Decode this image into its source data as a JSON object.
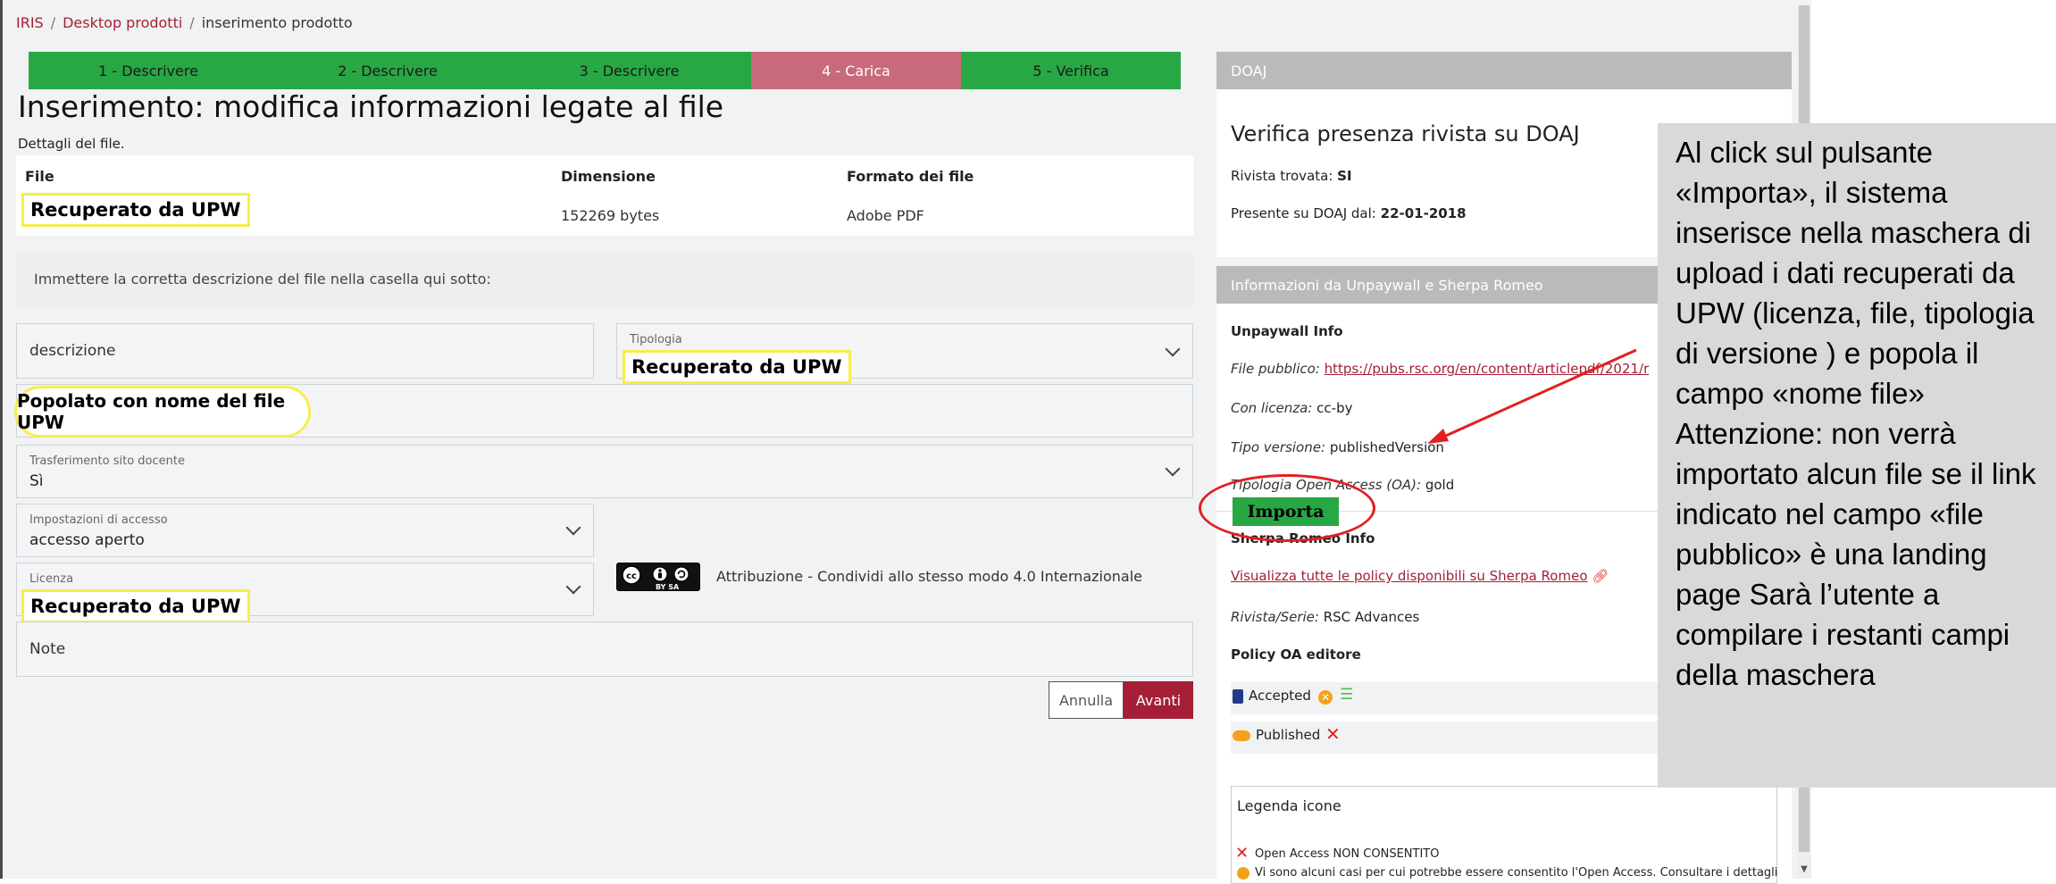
{
  "breadcrumb": {
    "root": "IRIS",
    "sep": "/",
    "desktop": "Desktop prodotti",
    "current": "inserimento prodotto"
  },
  "steps": [
    {
      "label": "1 - Descrivere",
      "state": "done"
    },
    {
      "label": "2 - Descrivere",
      "state": "done"
    },
    {
      "label": "3 - Descrivere",
      "state": "done"
    },
    {
      "label": "4 - Carica",
      "state": "active"
    },
    {
      "label": "5 - Verifica",
      "state": "done"
    }
  ],
  "form": {
    "title": "Inserimento: modifica informazioni legate al file",
    "subtitle": "Dettagli del file.",
    "table": {
      "headers": [
        "File",
        "Dimensione",
        "Formato dei file"
      ],
      "row": {
        "file": "Recuperato da UPW",
        "size": "152269 bytes",
        "format": "Adobe PDF"
      }
    },
    "instruction": "Immettere la corretta descrizione del file nella casella qui sotto:",
    "description_placeholder": "descrizione",
    "tipologia": {
      "label": "Tipologia",
      "value": "Recuperato da UPW"
    },
    "filename_value": "Popolato con nome del file UPW",
    "trasferimento": {
      "label": "Trasferimento sito docente",
      "value": "Sì"
    },
    "accesso": {
      "label": "Impostazioni di accesso",
      "value": "accesso aperto"
    },
    "licenza": {
      "label": "Licenza",
      "value": "Recuperato da UPW"
    },
    "cc_badge": "BY SA",
    "license_text": "Attribuzione - Condividi allo stesso modo 4.0 Internazionale",
    "note_placeholder": "Note",
    "buttons": {
      "cancel": "Annulla",
      "next": "Avanti"
    }
  },
  "doaj": {
    "header": "DOAJ",
    "title": "Verifica presenza rivista su DOAJ",
    "found_label": "Rivista trovata:",
    "found_value": "SI",
    "since_label": "Presente su DOAJ dal:",
    "since_value": "22-01-2018"
  },
  "info": {
    "header": "Informazioni da Unpaywall e Sherpa Romeo",
    "unpaywall_title": "Unpaywall Info",
    "public_file_label": "File pubblico:",
    "public_file_url": "https://pubs.rsc.org/en/content/articlepdf/2021/r",
    "licence_label": "Con licenza:",
    "licence_value": "cc-by",
    "version_label": "Tipo versione:",
    "version_value": "publishedVersion",
    "oa_label": "Tipologia Open Access (OA):",
    "oa_value": "gold",
    "import_button": "Importa",
    "sherpa_title": "Sherpa Romeo Info",
    "sherpa_link": "Visualizza tutte le policy disponibili su Sherpa Romeo",
    "journal_label": "Rivista/Serie:",
    "journal_value": "RSC Advances",
    "policy_title": "Policy OA editore",
    "accepted": "Accepted",
    "published": "Published",
    "legend_title": "Legenda icone",
    "legend_1": "Open Access NON CONSENTITO",
    "legend_2": "Vi sono alcuni casi per cui potrebbe essere consentito l'Open Access. Consultare i dettagli"
  },
  "callout": {
    "text": "Al click sul pulsante «Importa», il sistema inserisce nella maschera di upload i dati recuperati da UPW (licenza, file, tipologia di versione ) e popola il campo «nome file» Attenzione: non verrà importato alcun file se il link indicato nel campo «file pubblico» è una landing page Sarà l’utente a compilare i restanti campi della maschera"
  },
  "colors": {
    "accent": "#a51e36",
    "step_done": "#28a745",
    "step_active": "#c86a7b",
    "highlight": "#f6ee4c",
    "annotation": "#e02020"
  }
}
